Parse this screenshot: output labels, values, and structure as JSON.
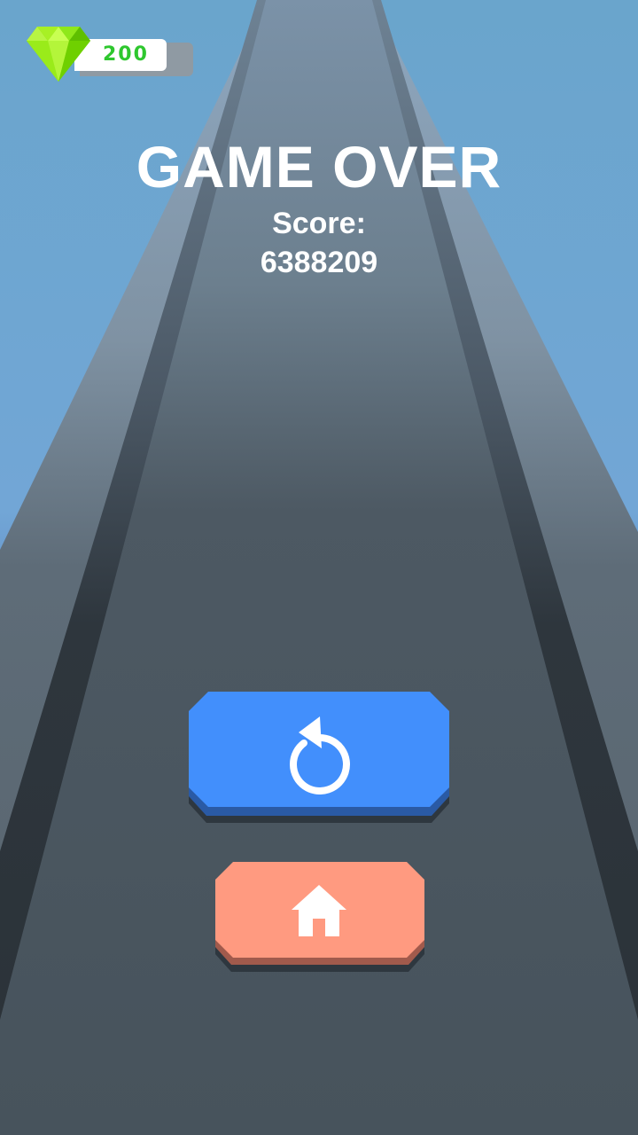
{
  "currency": {
    "amount": "200",
    "icon": "gem-icon",
    "color": "#2ec72e"
  },
  "game_over": {
    "title": "GAME OVER",
    "score_label": "Score:",
    "score_value": "6388209"
  },
  "buttons": {
    "restart": {
      "icon": "restart-icon",
      "color": "#428ffc",
      "shade": "#2a5aa5"
    },
    "home": {
      "icon": "home-icon",
      "color": "#ff9a80",
      "shade": "#a15a4c"
    }
  },
  "colors": {
    "sky": "#6fa6d2",
    "road": "#48545d",
    "road_edge": "#2b3238",
    "text": "#ffffff"
  }
}
